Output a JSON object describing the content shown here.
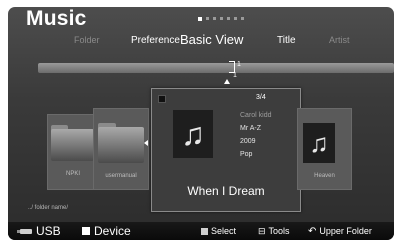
{
  "header": {
    "title": "Music"
  },
  "pager": {
    "total": 7,
    "current": 1
  },
  "tabs": [
    {
      "label": "Folder",
      "state": "dim"
    },
    {
      "label": "Preference",
      "state": "bright"
    },
    {
      "label": "Basic View",
      "state": "active"
    },
    {
      "label": "Title",
      "state": "bright"
    },
    {
      "label": "Artist",
      "state": "dim"
    }
  ],
  "scroll": {
    "top_number": "1",
    "bottom_number": "1"
  },
  "items": [
    {
      "label": "NPKI",
      "kind": "folder"
    },
    {
      "label": "usermanual",
      "kind": "folder"
    },
    {
      "label": "Heaven",
      "kind": "music"
    }
  ],
  "detail": {
    "index": "3/4",
    "artist": "Carol kidd",
    "sort": "Mr A-Z",
    "year": "2009",
    "genre": "Pop",
    "song_title": "When I Dream"
  },
  "folder_path": "../ folder name/",
  "bottom_bar": {
    "usb": "USB",
    "device": "Device",
    "select": "Select",
    "tools": "Tools",
    "upper_folder": "Upper Folder"
  },
  "icons": {
    "music_note": "music-note-icon",
    "folder": "folder-icon"
  },
  "colors": {
    "background": "#3a3a3a",
    "text_primary": "#ffffff",
    "text_dim": "#8a8a8a"
  }
}
